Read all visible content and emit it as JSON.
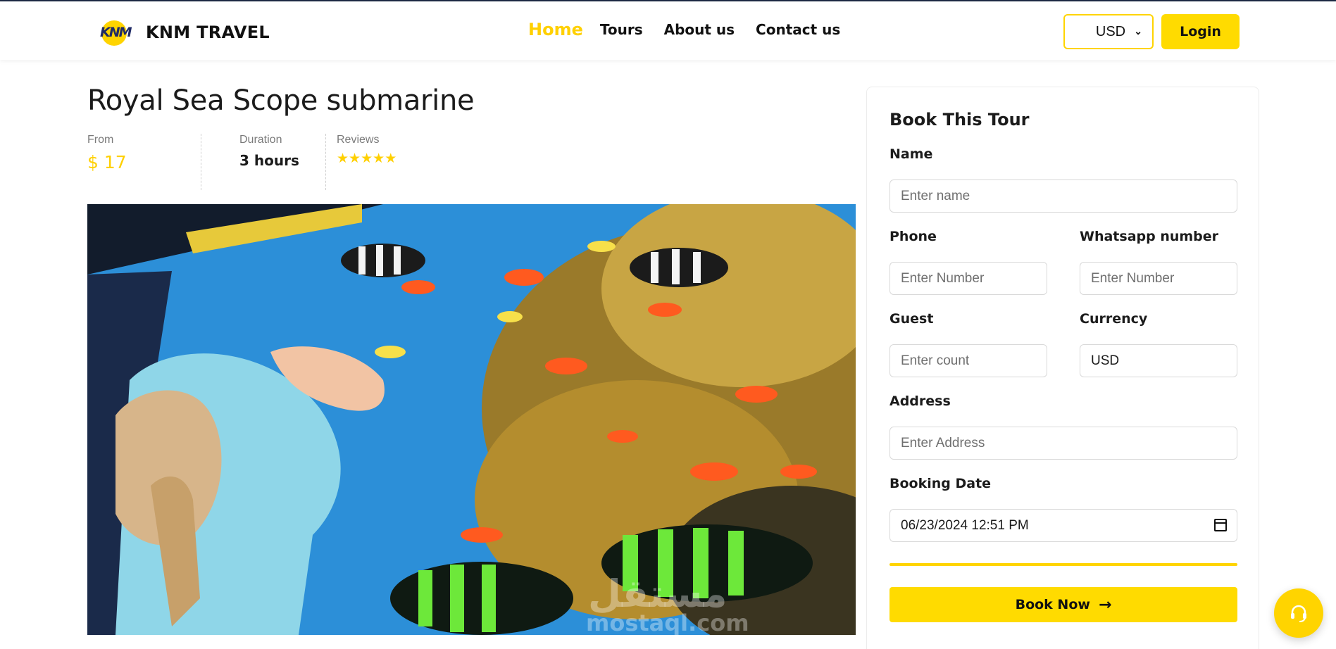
{
  "brand": {
    "logo_mark": "KNM",
    "name": "KNM TRAVEL"
  },
  "nav": {
    "items": [
      {
        "label": "Home",
        "active": true
      },
      {
        "label": "Tours",
        "active": false
      },
      {
        "label": "About us",
        "active": false
      },
      {
        "label": "Contact us",
        "active": false
      }
    ]
  },
  "header": {
    "currency_value": "USD",
    "login_label": "Login"
  },
  "tour": {
    "title": "Royal Sea Scope submarine",
    "from_label": "From",
    "price": "$ 17",
    "duration_label": "Duration",
    "duration": "3 hours",
    "reviews_label": "Reviews",
    "rating_stars": 5
  },
  "watermark": {
    "arabic": "مستقل",
    "latin": "mostaql.com"
  },
  "booking": {
    "title": "Book This Tour",
    "name_label": "Name",
    "name_placeholder": "Enter name",
    "phone_label": "Phone",
    "phone_placeholder": "Enter Number",
    "whatsapp_label": "Whatsapp number",
    "whatsapp_placeholder": "Enter Number",
    "guest_label": "Guest",
    "guest_placeholder": "Enter count",
    "currency_label": "Currency",
    "currency_value": "USD",
    "address_label": "Address",
    "address_placeholder": "Enter Address",
    "date_label": "Booking Date",
    "date_value": "06/23/2024 12:51 PM",
    "submit_label": "Book Now"
  },
  "colors": {
    "accent": "#ffd400",
    "text": "#1b1b1b",
    "muted": "#7a7a7a"
  },
  "icons": {
    "submit_arrow": "arrow-right-icon",
    "support": "headset-icon",
    "calendar": "calendar-icon",
    "select_chevron": "chevron-down-icon"
  }
}
